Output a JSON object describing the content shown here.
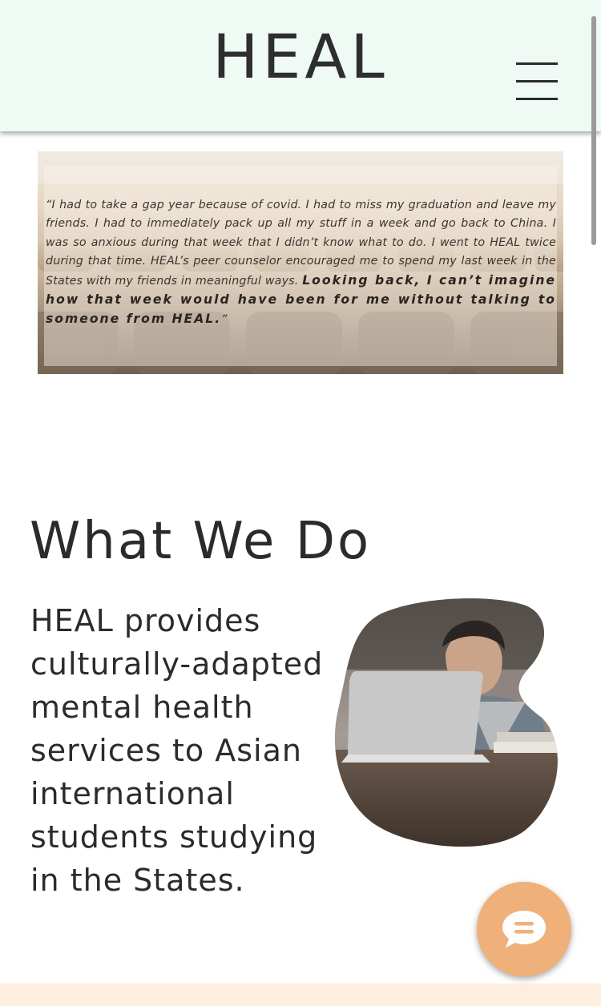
{
  "header": {
    "logo": "HEAL",
    "menu_icon": "hamburger-menu-icon"
  },
  "hero": {
    "quote_regular": "“I had to take a gap year because of covid. I had to miss my graduation and leave my friends. I had to immediately pack up all my stuff in a week and go back to China. I was so anxious during that week that I didn’t know what to do. I went to HEAL twice during that time. HEAL’s peer counselor encouraged me to spend my last week in the States with my friends in meaningful ways. ",
    "quote_bold": "Looking back, I can’t imagine how that week would have been for me without talking to someone from HEAL.",
    "quote_close": "”"
  },
  "what_we_do": {
    "title": "What We Do",
    "body": "HEAL provides culturally-adapted mental health services to Asian international students studying in the States."
  },
  "chat": {
    "icon": "chat-bubble-icon",
    "color": "#efb07a"
  },
  "colors": {
    "header_bg": "#eefaf3",
    "footer_band": "#fdeee0"
  }
}
